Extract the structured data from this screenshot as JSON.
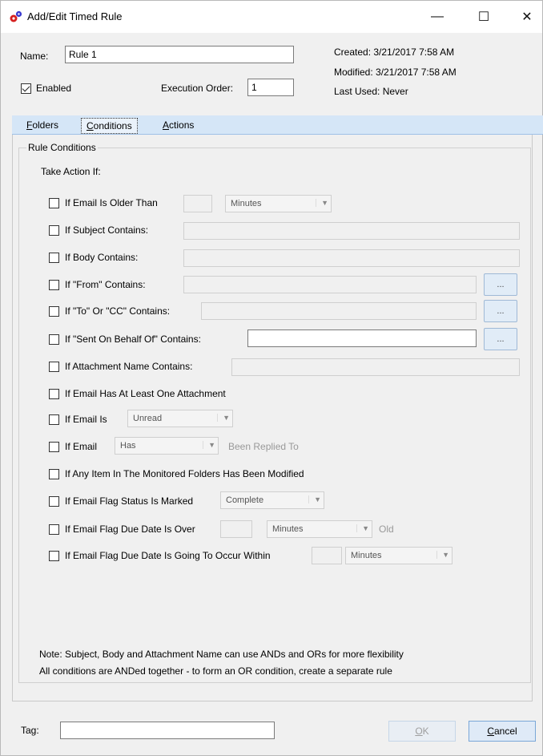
{
  "window": {
    "title": "Add/Edit Timed Rule",
    "minimize_glyph": "—",
    "maximize_glyph": "☐",
    "close_glyph": "✕"
  },
  "header": {
    "name_label": "Name:",
    "name_value": "Rule 1",
    "enabled_label": "Enabled",
    "enabled_checked": true,
    "execution_order_label": "Execution Order:",
    "execution_order_value": "1",
    "created": "Created: 3/21/2017 7:58 AM",
    "modified": "Modified: 3/21/2017 7:58 AM",
    "last_used": "Last Used: Never"
  },
  "tabs": [
    {
      "first": "F",
      "rest": "olders"
    },
    {
      "first": "C",
      "rest": "onditions"
    },
    {
      "first": "A",
      "rest": "ctions"
    }
  ],
  "active_tab": "Conditions",
  "conditions": {
    "group_title": "Rule Conditions",
    "take_action": "Take Action If:",
    "older_than": {
      "label": "If Email Is Older Than",
      "unit": "Minutes"
    },
    "subject": {
      "label": "If Subject Contains:"
    },
    "body": {
      "label": "If Body Contains:"
    },
    "from": {
      "label": "If \"From\" Contains:",
      "button": "..."
    },
    "to_cc": {
      "label": "If \"To\" Or \"CC\" Contains:",
      "button": "..."
    },
    "behalf": {
      "label": "If \"Sent On Behalf Of\" Contains:",
      "button": "..."
    },
    "attachment_name": {
      "label": "If Attachment Name Contains:"
    },
    "has_attachment": {
      "label": "If Email Has At Least One Attachment"
    },
    "email_is": {
      "label": "If Email Is",
      "value": "Unread"
    },
    "email_replied": {
      "label": "If Email",
      "value": "Has",
      "suffix": "Been Replied To"
    },
    "modified_item": {
      "label": "If Any Item In The Monitored Folders Has Been Modified"
    },
    "flag_status": {
      "label": "If Email Flag Status Is Marked",
      "value": "Complete"
    },
    "due_over": {
      "label": "If Email Flag Due Date Is Over",
      "unit": "Minutes",
      "suffix": "Old"
    },
    "due_within": {
      "label": "If Email Flag Due Date Is Going To Occur Within",
      "unit": "Minutes"
    },
    "note1": "Note: Subject, Body and Attachment Name can use ANDs and ORs for more flexibility",
    "note2": "All conditions are ANDed together - to form an OR condition, create a separate rule"
  },
  "footer": {
    "tag_label": "Tag:",
    "ok_first": "O",
    "ok_rest": "K",
    "cancel_first": "C",
    "cancel_rest": "ancel"
  }
}
